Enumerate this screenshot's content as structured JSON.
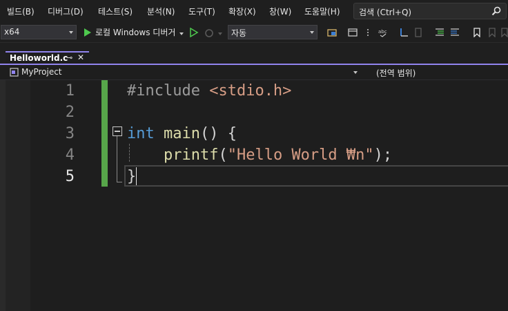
{
  "menu": [
    "빌드(B)",
    "디버그(D)",
    "테스트(S)",
    "분석(N)",
    "도구(T)",
    "확장(X)",
    "창(W)",
    "도움말(H)"
  ],
  "search": {
    "label": "검색 (Ctrl+Q)"
  },
  "toolbar": {
    "platform": "x64",
    "run_label": "로컬 Windows 디버거",
    "config": "자동"
  },
  "tab": {
    "title": "Helloworld.c",
    "pin_glyph": "⊸",
    "close_glyph": "✕"
  },
  "nav": {
    "project": "MyProject",
    "scope": "(전역 범위)"
  },
  "editor": {
    "line_numbers": [
      "1",
      "2",
      "3",
      "4",
      "5"
    ],
    "current_line": 5,
    "lines": [
      {
        "include": "#include",
        "header": "<stdio.h>"
      },
      {},
      {
        "type": "int",
        "name": "main",
        "rest": "() {"
      },
      {
        "fn": "printf",
        "open": "(",
        "str": "\"Hello World ₩n\"",
        "close": ");"
      },
      {
        "brace": "}"
      }
    ]
  },
  "colors": {
    "accent": "#9184ee",
    "keyword": "#569cd6",
    "string": "#d69d85",
    "function": "#dcdcaa",
    "change_bar": "#57a64a",
    "run": "#4ec94e"
  }
}
